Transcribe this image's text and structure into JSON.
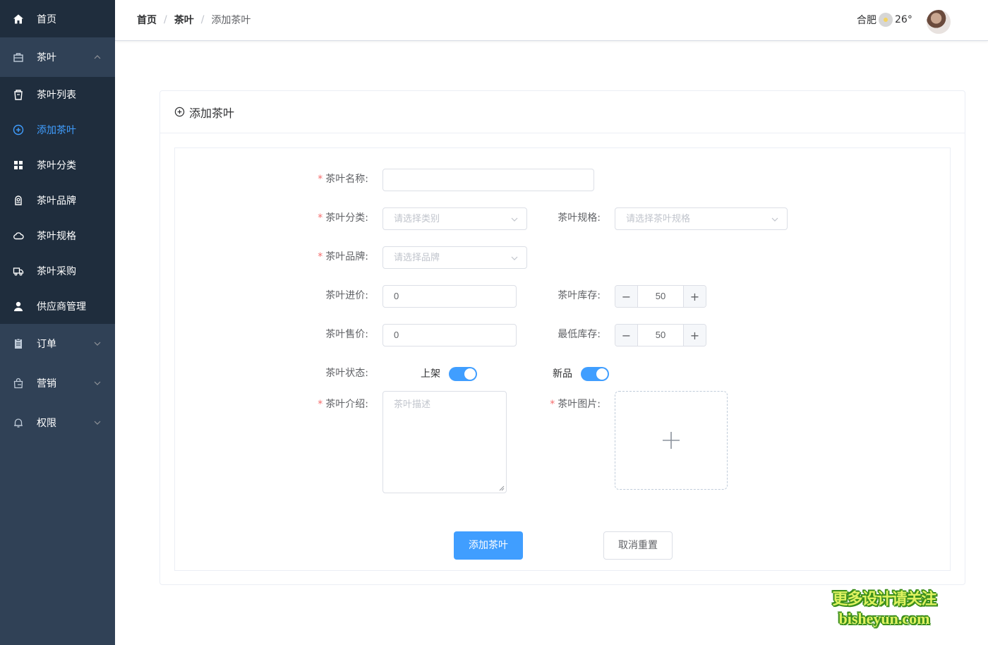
{
  "sidebar": {
    "home": "首页",
    "tea_group": "茶叶",
    "tea_items": [
      {
        "label": "茶叶列表",
        "icon": "cup-icon"
      },
      {
        "label": "添加茶叶",
        "icon": "plus-circle-icon",
        "active": true
      },
      {
        "label": "茶叶分类",
        "icon": "grid-icon"
      },
      {
        "label": "茶叶品牌",
        "icon": "brand-icon"
      },
      {
        "label": "茶叶规格",
        "icon": "cloud-icon"
      },
      {
        "label": "茶叶采购",
        "icon": "truck-icon"
      },
      {
        "label": "供应商管理",
        "icon": "user-icon"
      }
    ],
    "orders": "订单",
    "marketing": "营销",
    "permissions": "权限"
  },
  "header": {
    "breadcrumb": [
      "首页",
      "茶叶",
      "添加茶叶"
    ],
    "city": "合肥",
    "temperature": "26°"
  },
  "card": {
    "title": "添加茶叶"
  },
  "form": {
    "name_label": "茶叶名称:",
    "name_value": "",
    "category_label": "茶叶分类:",
    "category_placeholder": "请选择类别",
    "spec_label": "茶叶规格:",
    "spec_placeholder": "请选择茶叶规格",
    "brand_label": "茶叶品牌:",
    "brand_placeholder": "请选择品牌",
    "cost_label": "茶叶进价:",
    "cost_value": "0",
    "stock_label": "茶叶库存:",
    "stock_value": "50",
    "price_label": "茶叶售价:",
    "price_value": "0",
    "min_stock_label": "最低库存:",
    "min_stock_value": "50",
    "status_label": "茶叶状态:",
    "on_shelf_label": "上架",
    "new_label": "新品",
    "intro_label": "茶叶介绍:",
    "intro_placeholder": "茶叶描述",
    "image_label": "茶叶图片:",
    "submit": "添加茶叶",
    "reset": "取消重置"
  },
  "watermark": {
    "line1": "更多设计请关注",
    "line2": "bisheyun.com"
  },
  "colors": {
    "sidebar_bg": "#304156",
    "submenu_bg": "#1f2d3d",
    "accent": "#409eff",
    "required": "#f56c6c"
  }
}
